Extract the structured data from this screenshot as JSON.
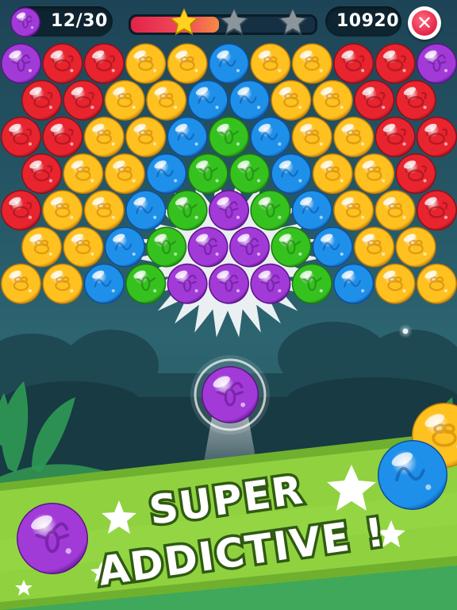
{
  "hud": {
    "moves_text": "12/30",
    "score_text": "10920",
    "progress_fraction": 0.48,
    "stars_earned": 1,
    "stars_total": 3,
    "close_icon": "close-icon",
    "close_glyph": "✕"
  },
  "banner": {
    "line1": "SUPER",
    "line2": "ADDICTIVE !"
  },
  "colors": {
    "red": "#e8242f",
    "orange": "#f7a21b",
    "yellow": "#ffc11f",
    "blue": "#1e90ea",
    "green": "#35c21f",
    "purple": "#a23ad8",
    "banner_green": "#8fd13f",
    "star_gold": "#ffd21f"
  },
  "grid": {
    "rows": [
      "PRRYYBYYRRP",
      "RRYYBBYYRR",
      "RRYYBGBYYRR",
      "RYYBGGBYYR",
      "RYYBGPGBYYR",
      "YYBGPPGBYY",
      "YYBGPPPGBYY"
    ]
  },
  "shooter": {
    "current": "P",
    "next": "P"
  },
  "decor": {
    "left_bubble": "P",
    "right_top_bubble": "Y",
    "right_bubble": "B"
  },
  "icons": {
    "R": "crab-icon",
    "Y": "bee-icon",
    "O": "bee-icon",
    "B": "worm-icon",
    "G": "fly-icon",
    "P": "scorpion-icon"
  }
}
